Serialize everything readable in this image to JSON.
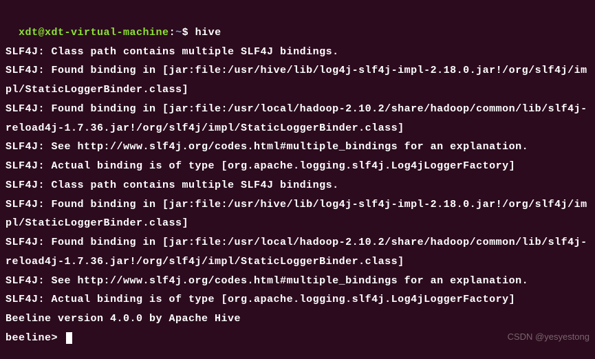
{
  "prompt": {
    "user_host": "xdt@xdt-virtual-machine",
    "colon": ":",
    "path": "~",
    "dollar": "$ ",
    "command": "hive"
  },
  "output_lines": [
    "SLF4J: Class path contains multiple SLF4J bindings.",
    "SLF4J: Found binding in [jar:file:/usr/hive/lib/log4j-slf4j-impl-2.18.0.jar!/org/slf4j/impl/StaticLoggerBinder.class]",
    "SLF4J: Found binding in [jar:file:/usr/local/hadoop-2.10.2/share/hadoop/common/lib/slf4j-reload4j-1.7.36.jar!/org/slf4j/impl/StaticLoggerBinder.class]",
    "SLF4J: See http://www.slf4j.org/codes.html#multiple_bindings for an explanation.",
    "SLF4J: Actual binding is of type [org.apache.logging.slf4j.Log4jLoggerFactory]",
    "SLF4J: Class path contains multiple SLF4J bindings.",
    "SLF4J: Found binding in [jar:file:/usr/hive/lib/log4j-slf4j-impl-2.18.0.jar!/org/slf4j/impl/StaticLoggerBinder.class]",
    "SLF4J: Found binding in [jar:file:/usr/local/hadoop-2.10.2/share/hadoop/common/lib/slf4j-reload4j-1.7.36.jar!/org/slf4j/impl/StaticLoggerBinder.class]",
    "SLF4J: See http://www.slf4j.org/codes.html#multiple_bindings for an explanation.",
    "SLF4J: Actual binding is of type [org.apache.logging.slf4j.Log4jLoggerFactory]",
    "Beeline version 4.0.0 by Apache Hive"
  ],
  "beeline_prompt": "beeline> ",
  "watermark": "CSDN @yesyestong"
}
